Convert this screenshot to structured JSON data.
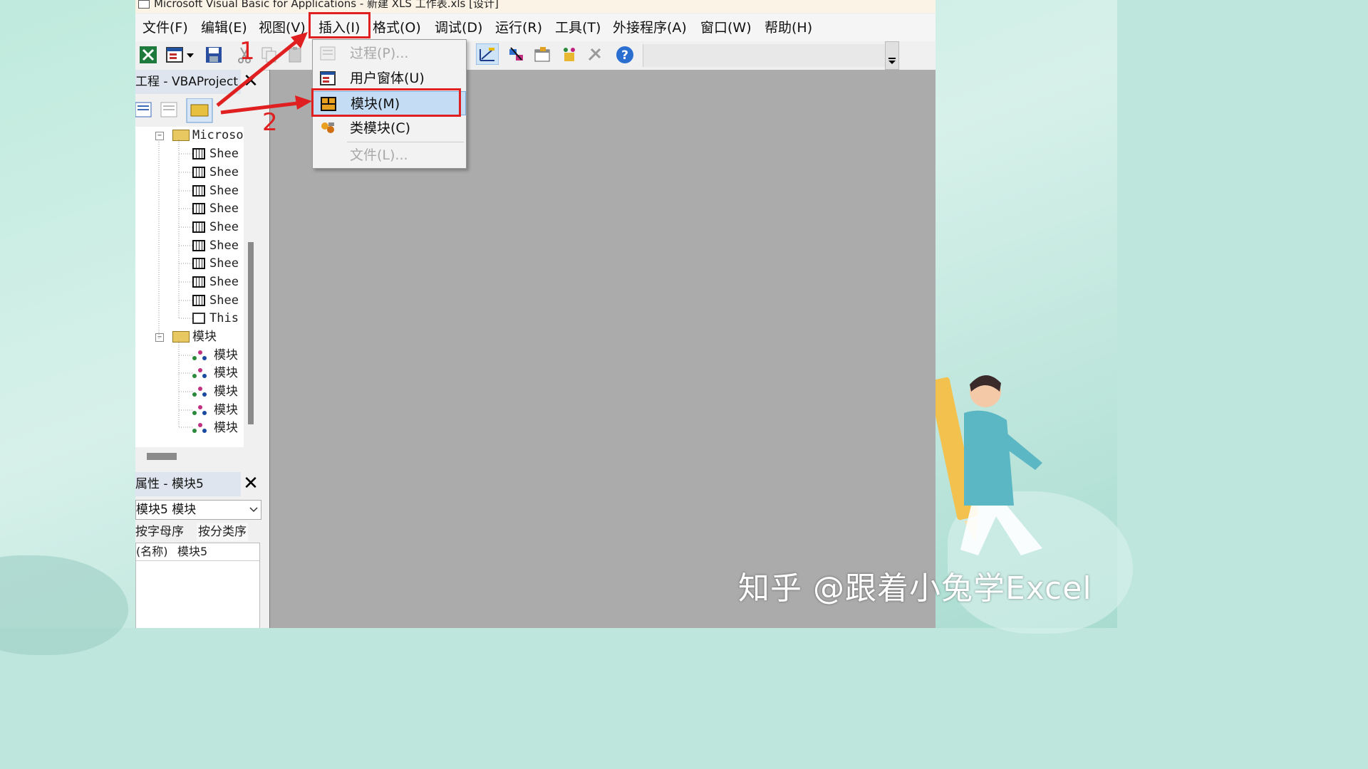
{
  "window": {
    "title": "Microsoft Visual Basic for Applications - 新建 XLS 工作表.xls [设计]"
  },
  "menubar": {
    "items": [
      "文件(F)",
      "编辑(E)",
      "视图(V)",
      "插入(I)",
      "格式(O)",
      "调试(D)",
      "运行(R)",
      "工具(T)",
      "外接程序(A)",
      "窗口(W)",
      "帮助(H)"
    ]
  },
  "insert_menu": {
    "items": [
      {
        "label": "过程(P)...",
        "icon": "procedure-icon",
        "enabled": false
      },
      {
        "label": "用户窗体(U)",
        "icon": "userform-icon",
        "enabled": true
      },
      {
        "label": "模块(M)",
        "icon": "module-icon",
        "enabled": true,
        "highlighted": true
      },
      {
        "label": "类模块(C)",
        "icon": "class-module-icon",
        "enabled": true
      },
      {
        "label": "文件(L)...",
        "icon": "",
        "enabled": false
      }
    ]
  },
  "project_explorer": {
    "title": "工程 - VBAProject",
    "tree": {
      "excel_objects_folder": "Microso",
      "sheets": [
        "Shee",
        "Shee",
        "Shee",
        "Shee",
        "Shee",
        "Shee",
        "Shee",
        "Shee",
        "Shee"
      ],
      "this_workbook": "This",
      "modules_folder": "模块",
      "modules": [
        "模块",
        "模块",
        "模块",
        "模块",
        "模块"
      ]
    }
  },
  "properties": {
    "title": "属性 - 模块5",
    "object_combo": "模块5 模块",
    "tab_alpha": "按字母序",
    "tab_category": "按分类序",
    "rows": [
      {
        "name": "(名称)",
        "value": "模块5"
      }
    ]
  },
  "annotations": {
    "step1": "1",
    "step2": "2",
    "color": "#e02020"
  },
  "watermark": "知乎 @跟着小兔学Excel",
  "colors": {
    "workspace": "#ababab",
    "menu_highlight": "#c4dcf4",
    "background": "#bfe6dc"
  }
}
